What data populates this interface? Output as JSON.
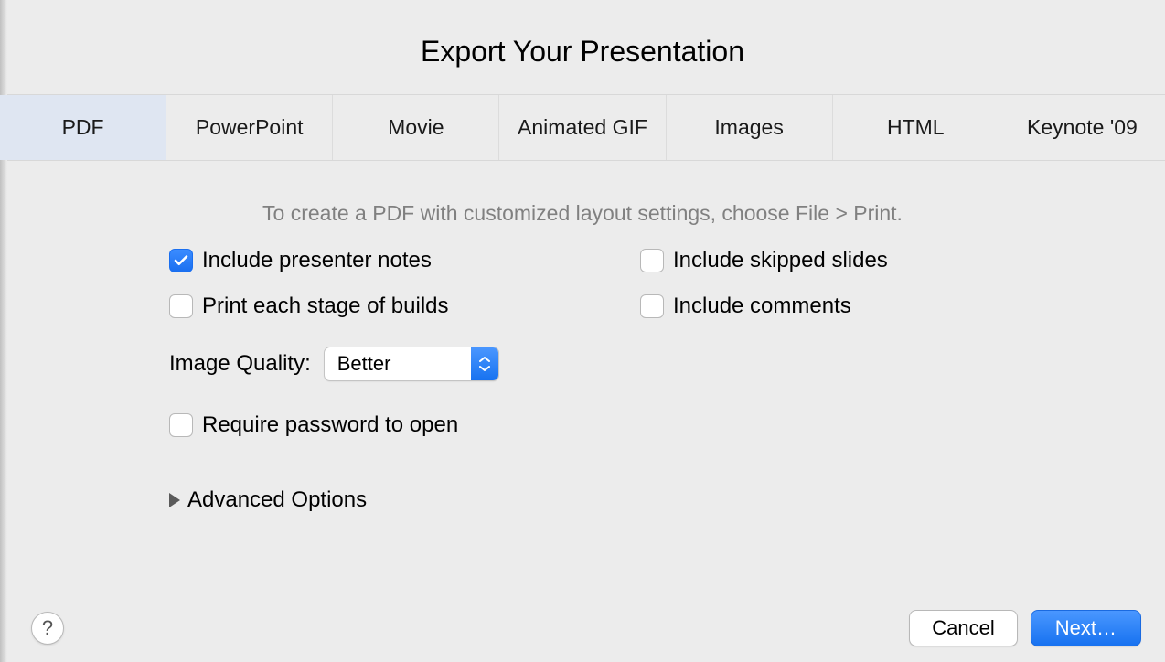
{
  "title": "Export Your Presentation",
  "tabs": [
    {
      "label": "PDF",
      "active": true
    },
    {
      "label": "PowerPoint",
      "active": false
    },
    {
      "label": "Movie",
      "active": false
    },
    {
      "label": "Animated GIF",
      "active": false
    },
    {
      "label": "Images",
      "active": false
    },
    {
      "label": "HTML",
      "active": false
    },
    {
      "label": "Keynote '09",
      "active": false
    }
  ],
  "helper_text": "To create a PDF with customized layout settings, choose File > Print.",
  "options": {
    "include_presenter_notes": {
      "label": "Include presenter notes",
      "checked": true
    },
    "include_skipped_slides": {
      "label": "Include skipped slides",
      "checked": false
    },
    "print_each_stage": {
      "label": "Print each stage of builds",
      "checked": false
    },
    "include_comments": {
      "label": "Include comments",
      "checked": false
    }
  },
  "image_quality": {
    "label": "Image Quality:",
    "value": "Better"
  },
  "require_password": {
    "label": "Require password to open",
    "checked": false
  },
  "advanced_options_label": "Advanced Options",
  "footer": {
    "help": "?",
    "cancel": "Cancel",
    "next": "Next…"
  }
}
